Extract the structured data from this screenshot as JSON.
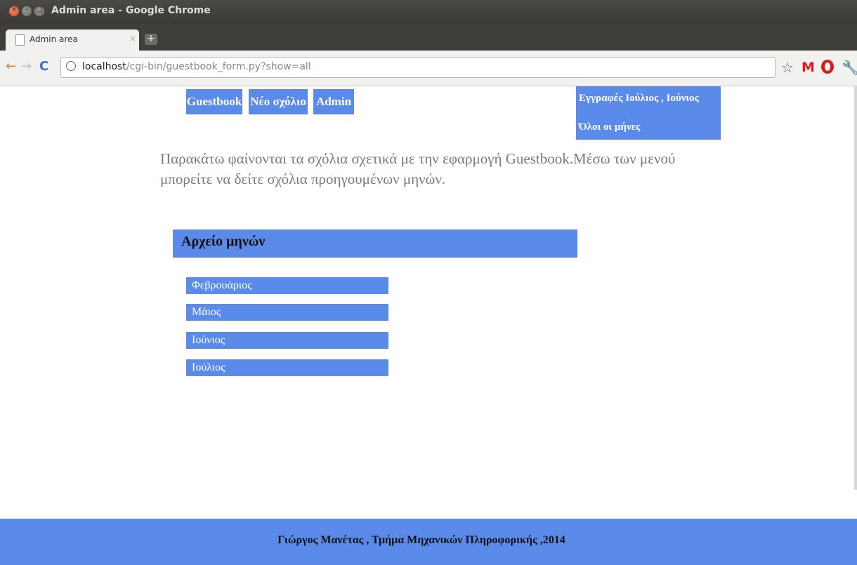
{
  "window": {
    "title": "Admin area - Google Chrome",
    "controls": {
      "close": "×",
      "minimize": "–",
      "maximize": "□"
    }
  },
  "tab": {
    "label": "Admin area",
    "close": "×",
    "new_tab": "+"
  },
  "toolbar": {
    "back": "←",
    "forward": "→",
    "reload": "C",
    "url_host": "localhost",
    "url_path": "/cgi-bin/guestbook_form.py?show=all",
    "bookmark": "☆",
    "gmail": "M",
    "settings": "🔧"
  },
  "nav": {
    "guestbook": "Guestbook",
    "new_comment": "Νέο σχόλιο",
    "admin": "Admin"
  },
  "side_menu": {
    "entries": "Εγγραφές Ιούλιος , Ιούνιος",
    "all_months": "Όλοι οι μήνες"
  },
  "intro": "Παρακάτω φαίνονται τα σχόλια σχετικά με την εφαρμογή Guestbook.Μέσω των μενού μπορείτε να δείτε σχόλια προηγουμένων μηνών.",
  "archive": {
    "heading": "Αρχείο μηνών",
    "months": [
      "Φεβρουάριος",
      "Μάιος",
      "Ιούνιος",
      "Ιούλιος"
    ]
  },
  "footer": "Γιώργος Μανέτας , Τμήμα Μηχανικών Πληροφορικής ,2014",
  "colors": {
    "accent": "#5b8bea",
    "titlebar": "#3a3936",
    "toolbar": "#f1f1ef"
  }
}
